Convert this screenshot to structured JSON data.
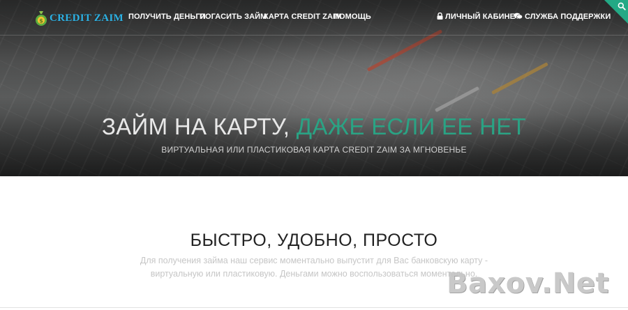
{
  "brand": {
    "logo_text": "CREDIT ZAIM"
  },
  "nav": {
    "items": [
      {
        "label": "ПОЛУЧИТЬ ДЕНЬГИ"
      },
      {
        "label": "ПОГАСИТЬ ЗАЙМ"
      },
      {
        "label": "КАРТА CREDIT ZAIM"
      },
      {
        "label": "ПОМОЩЬ"
      }
    ],
    "account_label": "ЛИЧНЫЙ КАБИНЕТ",
    "account_icon": "lock-icon",
    "support_label": "СЛУЖБА ПОДДЕРЖКИ",
    "support_icon": "chat-icon",
    "search_icon": "search-icon"
  },
  "hero": {
    "title_main": "ЗАЙМ НА КАРТУ,",
    "title_accent": "ДАЖЕ ЕСЛИ ЕЕ НЕТ",
    "subtitle": "ВИРТУАЛЬНАЯ ИЛИ ПЛАСТИКОВАЯ КАРТА CREDIT ZAIM ЗА МГНОВЕНЬЕ"
  },
  "features": {
    "title": "БЫСТРО, УДОБНО, ПРОСТО",
    "text_line1": "Для получения займа наш сервис моментально выпустит для Вас банковскую карту -",
    "text_line2": "виртуальную или пластиковую. Деньгами можно воспользоваться моментально."
  },
  "watermark": {
    "text": "Baxov.Net"
  },
  "colors": {
    "accent": "#2aa384",
    "logo": "#2db3e6",
    "search_corner": "#23a985"
  }
}
